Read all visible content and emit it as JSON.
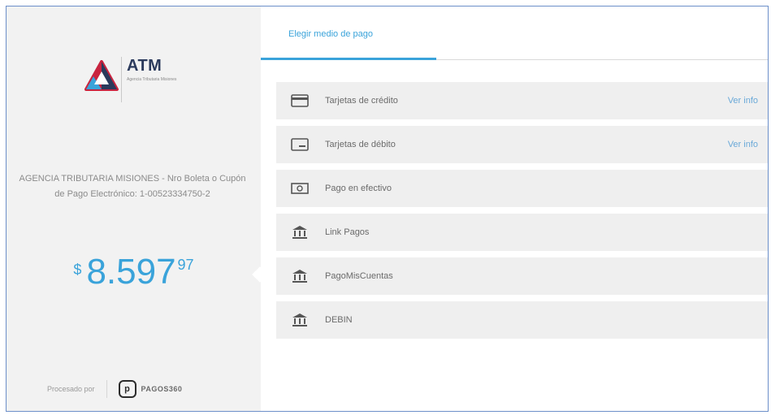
{
  "merchant": {
    "logo_name": "ATM",
    "logo_subtitle": "Agencia Tributaria Misiones",
    "description": "AGENCIA TRIBUTARIA MISIONES - Nro Boleta o Cupón de Pago Electrónico: 1-00523334750-2",
    "amount": {
      "currency": "$",
      "integer": "8.597",
      "decimals": "97"
    },
    "processed_by": "Procesado por",
    "processor": {
      "icon": "p",
      "name": "PAGOS360"
    }
  },
  "tabs": [
    {
      "label": "Elegir medio de pago",
      "active": true
    }
  ],
  "methods": [
    {
      "icon": "credit-card-icon",
      "label": "Tarjetas de crédito",
      "info": "Ver info"
    },
    {
      "icon": "debit-card-icon",
      "label": "Tarjetas de débito",
      "info": "Ver info"
    },
    {
      "icon": "cash-icon",
      "label": "Pago en efectivo",
      "info": ""
    },
    {
      "icon": "bank-icon",
      "label": "Link Pagos",
      "info": ""
    },
    {
      "icon": "bank-icon",
      "label": "PagoMisCuentas",
      "info": ""
    },
    {
      "icon": "bank-icon",
      "label": "DEBIN",
      "info": ""
    }
  ],
  "colors": {
    "accent": "#3aa3da",
    "panel": "#f2f2f2",
    "row": "#efefef",
    "border": "#6c8fc9"
  }
}
